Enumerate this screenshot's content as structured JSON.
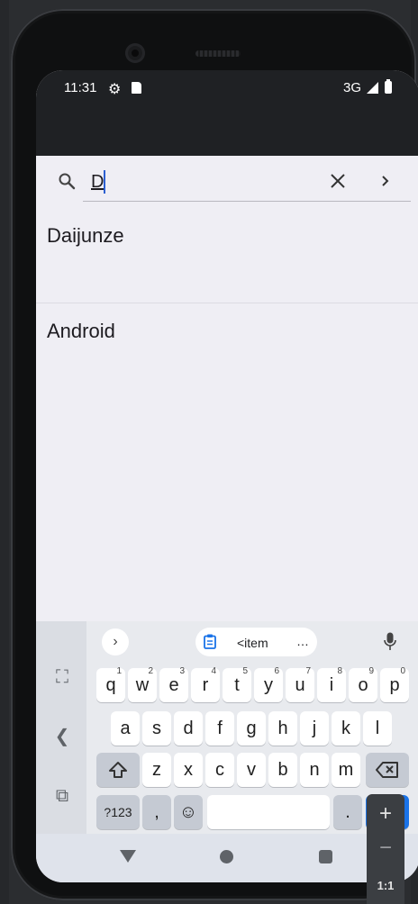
{
  "status_bar": {
    "time": "11:31",
    "network": "3G"
  },
  "search": {
    "query": "D"
  },
  "results": [
    {
      "label": "Daijunze"
    },
    {
      "label": "Android"
    }
  ],
  "keyboard": {
    "clipboard_suggestion": "<item",
    "clipboard_more": "…",
    "row1": [
      {
        "k": "q",
        "n": "1"
      },
      {
        "k": "w",
        "n": "2"
      },
      {
        "k": "e",
        "n": "3"
      },
      {
        "k": "r",
        "n": "4"
      },
      {
        "k": "t",
        "n": "5"
      },
      {
        "k": "y",
        "n": "6"
      },
      {
        "k": "u",
        "n": "7"
      },
      {
        "k": "i",
        "n": "8"
      },
      {
        "k": "o",
        "n": "9"
      },
      {
        "k": "p",
        "n": "0"
      }
    ],
    "row2": [
      "a",
      "s",
      "d",
      "f",
      "g",
      "h",
      "j",
      "k",
      "l"
    ],
    "row3": [
      "z",
      "x",
      "c",
      "v",
      "b",
      "n",
      "m"
    ],
    "symbols_label": "?123",
    "comma": ",",
    "period": "."
  },
  "emulator": {
    "zoom_in": "+",
    "zoom_out": "−",
    "zoom_ratio": "1:1"
  }
}
